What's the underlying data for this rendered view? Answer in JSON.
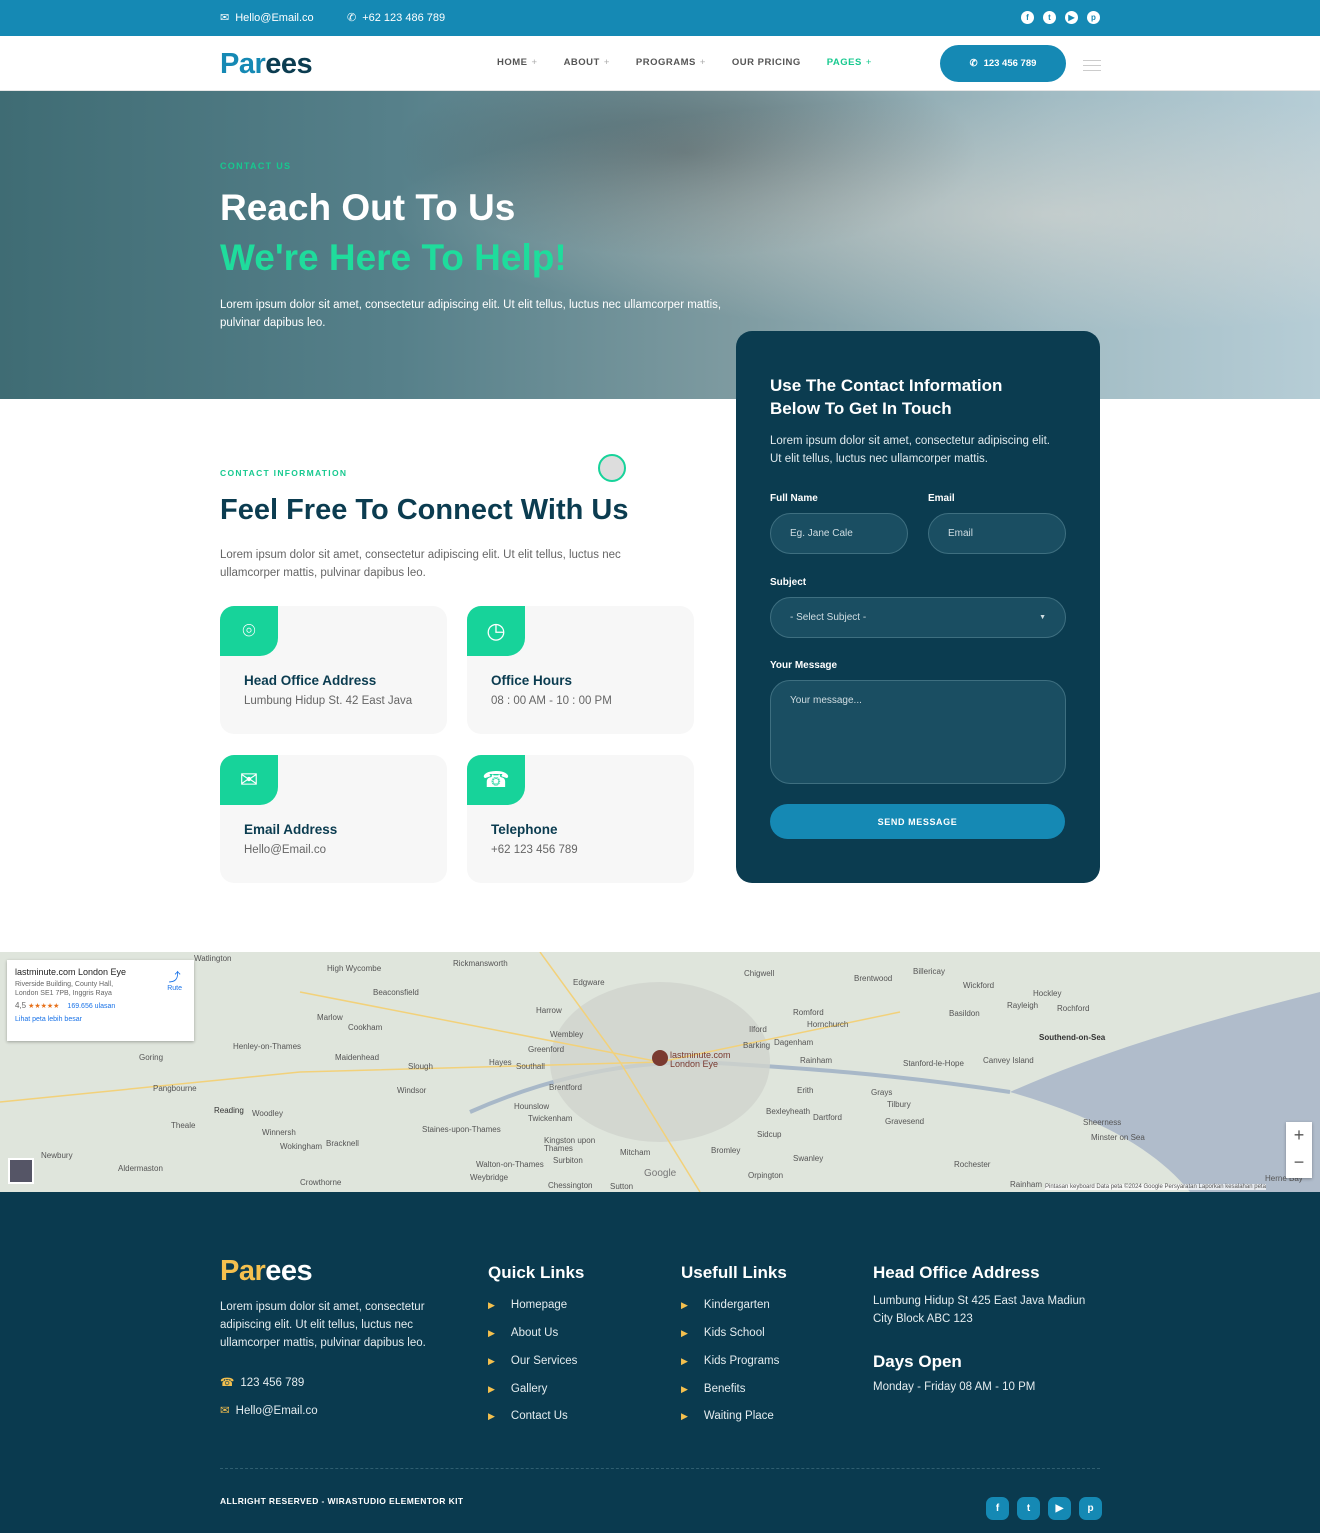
{
  "topbar": {
    "email": "Hello@Email.co",
    "phone": "+62 123 486 789",
    "social": [
      "facebook",
      "twitter",
      "youtube",
      "pinterest"
    ]
  },
  "nav": {
    "logo_a": "Par",
    "logo_b": "ees",
    "items": [
      {
        "label": "HOME",
        "plus": true
      },
      {
        "label": "ABOUT",
        "plus": true
      },
      {
        "label": "PROGRAMS",
        "plus": true
      },
      {
        "label": "OUR PRICING",
        "plus": false
      },
      {
        "label": "PAGES",
        "plus": true,
        "active": true
      }
    ],
    "call": "123 456 789"
  },
  "hero": {
    "eyebrow": "CONTACT US",
    "title": "Reach Out To Us",
    "subtitle": "We're Here To Help!",
    "text": "Lorem ipsum dolor sit amet, consectetur adipiscing elit. Ut elit tellus, luctus nec ullamcorper mattis, pulvinar dapibus leo."
  },
  "contact": {
    "eyebrow": "CONTACT INFORMATION",
    "title": "Feel Free To Connect With Us",
    "text": "Lorem ipsum dolor sit amet, consectetur adipiscing elit. Ut elit tellus, luctus nec ullamcorper mattis, pulvinar dapibus leo.",
    "cards": [
      {
        "icon": "map-pin",
        "title": "Head Office Address",
        "value": "Lumbung Hidup St. 42 East Java"
      },
      {
        "icon": "clock",
        "title": "Office Hours",
        "value": "08 : 00 AM - 10 : 00 PM"
      },
      {
        "icon": "email",
        "title": "Email Address",
        "value": "Hello@Email.co"
      },
      {
        "icon": "telephone",
        "title": "Telephone",
        "value": "+62 123 456 789"
      }
    ]
  },
  "form": {
    "title": "Use The Contact Information Below To Get In Touch",
    "text": "Lorem ipsum dolor sit amet, consectetur adipiscing elit. Ut elit tellus, luctus nec ullamcorper mattis.",
    "name_label": "Full Name",
    "name_placeholder": "Eg. Jane Cale",
    "email_label": "Email",
    "email_placeholder": "Email",
    "subject_label": "Subject",
    "subject_value": "- Select Subject -",
    "message_label": "Your Message",
    "message_placeholder": "Your message...",
    "submit": "SEND MESSAGE"
  },
  "map": {
    "place": "lastminute.com London Eye",
    "address": "Riverside Building, County Hall, London SE1 7PB, Inggris Raya",
    "rating": "4,5",
    "stars": "★★★★★",
    "reviews": "169.656 ulasan",
    "larger": "Lihat peta lebih besar",
    "route": "Rute",
    "marker": "lastminute.com London Eye",
    "attribution": "Pintasan keyboard   Data peta ©2024 Google   Persyaratan   Laporkan kesalahan peta",
    "google": "Google",
    "labels": [
      "Watlington",
      "High Wycombe",
      "Rickmansworth",
      "Edgware",
      "Chigwell",
      "Brentwood",
      "Billericay",
      "Wickford",
      "Hockley",
      "Rochford",
      "Beaconsfield",
      "Harrow",
      "Romford",
      "Hornchurch",
      "Basildon",
      "Rayleigh",
      "Southend-on-Sea",
      "Marlow",
      "Cookham",
      "Wembley",
      "Ilford",
      "Barking",
      "Dagenham",
      "Henley-on-Thames",
      "Maidenhead",
      "Slough",
      "Greenford",
      "Hayes",
      "Southall",
      "Rainham",
      "Stanford-le-Hope",
      "Canvey Island",
      "Goring",
      "Pangbourne",
      "Windsor",
      "Brentford",
      "Erith",
      "Grays",
      "Tilbury",
      "Reading",
      "Woodley",
      "Hounslow",
      "Twickenham",
      "Bexleyheath",
      "Dartford",
      "Gravesend",
      "Sheerness",
      "Theale",
      "Winnersh",
      "Wokingham",
      "Bracknell",
      "Staines-upon-Thames",
      "Kingston upon Thames",
      "Sidcup",
      "Bromley",
      "Mitcham",
      "Swanley",
      "Rochester",
      "Minster on Sea",
      "Newbury",
      "Aldermaston",
      "Crowthorne",
      "Walton-on-Thames",
      "Surbiton",
      "Weybridge",
      "Chessington",
      "Sutton",
      "Orpington",
      "Rainham",
      "Herne Bay"
    ]
  },
  "footer": {
    "logo_a": "Par",
    "logo_b": "ees",
    "text": "Lorem ipsum dolor sit amet, consectetur adipiscing elit. Ut elit tellus, luctus nec ullamcorper mattis, pulvinar dapibus leo.",
    "phone": "123 456 789",
    "email": "Hello@Email.co",
    "quick_title": "Quick Links",
    "quick": [
      "Homepage",
      "About Us",
      "Our Services",
      "Gallery",
      "Contact Us"
    ],
    "useful_title": "Usefull Links",
    "useful": [
      "Kindergarten",
      "Kids School",
      "Kids Programs",
      "Benefits",
      "Waiting Place"
    ],
    "office_title": "Head Office Address",
    "office": "Lumbung Hidup St 425 East Java Madiun City Block ABC 123",
    "days_title": "Days Open",
    "days": "Monday - Friday 08 AM - 10 PM",
    "copyright": "ALLRIGHT RESERVED - WIRASTUDIO ELEMENTOR KIT",
    "social": [
      "facebook",
      "twitter",
      "youtube",
      "pinterest"
    ]
  },
  "colors": {
    "primary": "#1589b4",
    "dark": "#0b3c50",
    "accent": "#17d39a",
    "footer_accent": "#f4c04e"
  }
}
